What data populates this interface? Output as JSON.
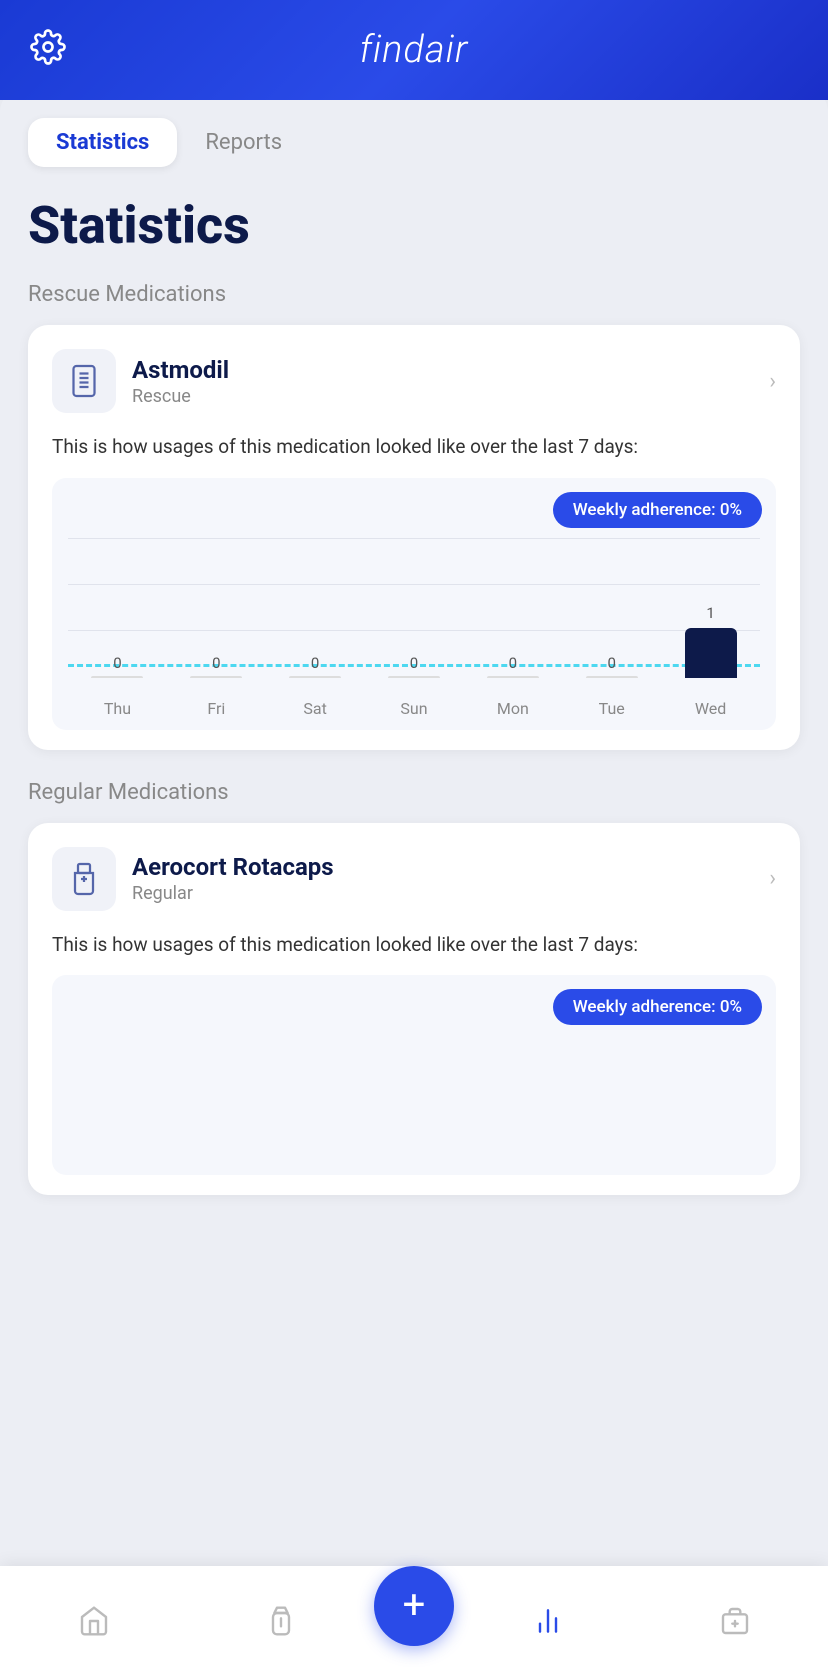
{
  "header": {
    "logo": "findair",
    "gear_label": "Settings"
  },
  "tabs": [
    {
      "id": "statistics",
      "label": "Statistics",
      "active": true
    },
    {
      "id": "reports",
      "label": "Reports",
      "active": false
    }
  ],
  "page": {
    "title": "Statistics"
  },
  "rescue_section": {
    "heading": "Rescue Medications",
    "medication": {
      "name": "Astmodil",
      "type": "Rescue",
      "description": "This is how usages of this medication looked like over the last 7 days:",
      "adherence_label": "Weekly adherence:",
      "adherence_value": "0%",
      "chart": {
        "days": [
          "Thu",
          "Fri",
          "Sat",
          "Sun",
          "Mon",
          "Tue",
          "Wed"
        ],
        "values": [
          0,
          0,
          0,
          0,
          0,
          0,
          1
        ],
        "highlighted_day": 6
      }
    }
  },
  "regular_section": {
    "heading": "Regular Medications",
    "medication": {
      "name": "Aerocort Rotacaps",
      "type": "Regular",
      "description": "This is how usages of this medication looked like over the last 7 days:",
      "adherence_label": "Weekly adherence:",
      "adherence_value": "0%"
    }
  },
  "bottom_nav": {
    "items": [
      {
        "id": "home",
        "label": "Home",
        "active": false
      },
      {
        "id": "inhaler",
        "label": "Inhaler",
        "active": false
      },
      {
        "id": "add",
        "label": "Add",
        "is_fab": true
      },
      {
        "id": "statistics",
        "label": "Statistics",
        "active": true
      },
      {
        "id": "kit",
        "label": "Kit",
        "active": false
      }
    ]
  }
}
